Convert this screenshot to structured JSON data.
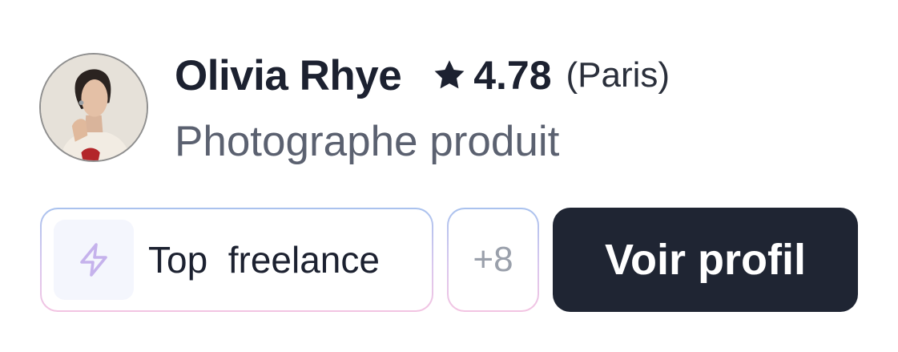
{
  "profile": {
    "name": "Olivia Rhye",
    "rating": "4.78",
    "location": "(Paris)",
    "title": "Photographe produit"
  },
  "icons": {
    "rating": "star-icon",
    "badge": "lightning-bolt-icon"
  },
  "badges": {
    "primary_label": "Top  freelance",
    "more_count": "+8"
  },
  "actions": {
    "view_profile_label": "Voir profil"
  },
  "colors": {
    "text_primary": "#1c2130",
    "text_secondary": "#5b6170",
    "cta_background": "#1f2533",
    "badge_gradient_top": "#a9c2ee",
    "badge_gradient_bottom": "#f3c4e2",
    "bolt_icon": "#c5b2ec"
  }
}
